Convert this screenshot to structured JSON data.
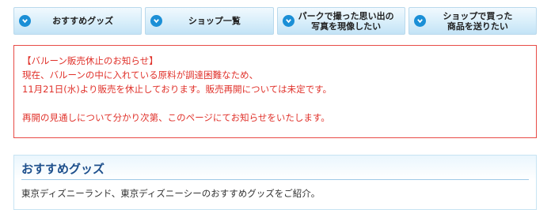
{
  "nav": {
    "items": [
      {
        "label": "おすすめグッズ",
        "icon": "chevron-down-icon"
      },
      {
        "label": "ショップ一覧",
        "icon": "chevron-down-icon"
      },
      {
        "label": "パークで撮った思い出の\n写真を現像したい",
        "icon": "chevron-down-icon"
      },
      {
        "label": "ショップで買った\n商品を送りたい",
        "icon": "chevron-down-icon"
      }
    ]
  },
  "notice": {
    "title": "【バルーン販売休止のお知らせ】",
    "line1": "現在、バルーンの中に入れている原料が調達困難なため、",
    "line2": "11月21日(水)より販売を休止しております。販売再開については未定です。",
    "line3": "再開の見通しについて分かり次第、このページにてお知らせをいたします。"
  },
  "section": {
    "title": "おすすめグッズ",
    "description": "東京ディズニーランド、東京ディズニーシーのおすすめグッズをご紹介。"
  },
  "colors": {
    "accent": "#1b8fd6",
    "notice": "#e0322b",
    "heading": "#1d4f8c"
  }
}
